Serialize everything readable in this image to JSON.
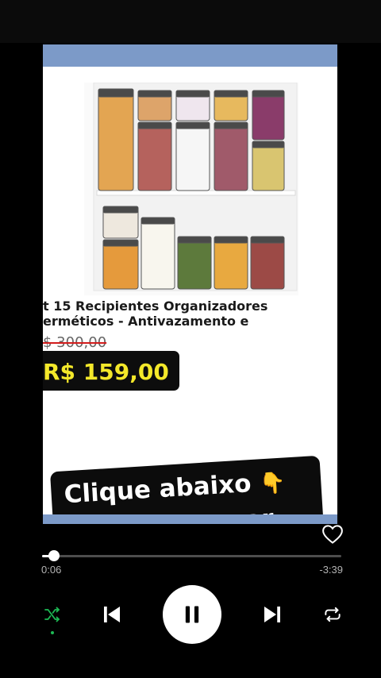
{
  "ad": {
    "title": "t 15 Recipientes Organizadores\nerméticos - Antivazamento e",
    "old_price": "$ 300,00",
    "new_price": "R$ 159,00",
    "cta_line1": "Clique abaixo",
    "cta_emoji": "👇",
    "cta_line2": "comprar"
  },
  "player": {
    "progress_fraction": 0.04,
    "elapsed": "0:06",
    "remaining": "-3:39",
    "state": "playing",
    "shuffle_active": true,
    "liked": false
  },
  "colors": {
    "accent_green": "#1db954",
    "price_yellow": "#f4e82a",
    "band_blue": "#7c9ac8"
  },
  "icons": [
    "heart-icon",
    "shuffle-icon",
    "previous-icon",
    "pause-icon",
    "next-icon",
    "repeat-icon"
  ]
}
